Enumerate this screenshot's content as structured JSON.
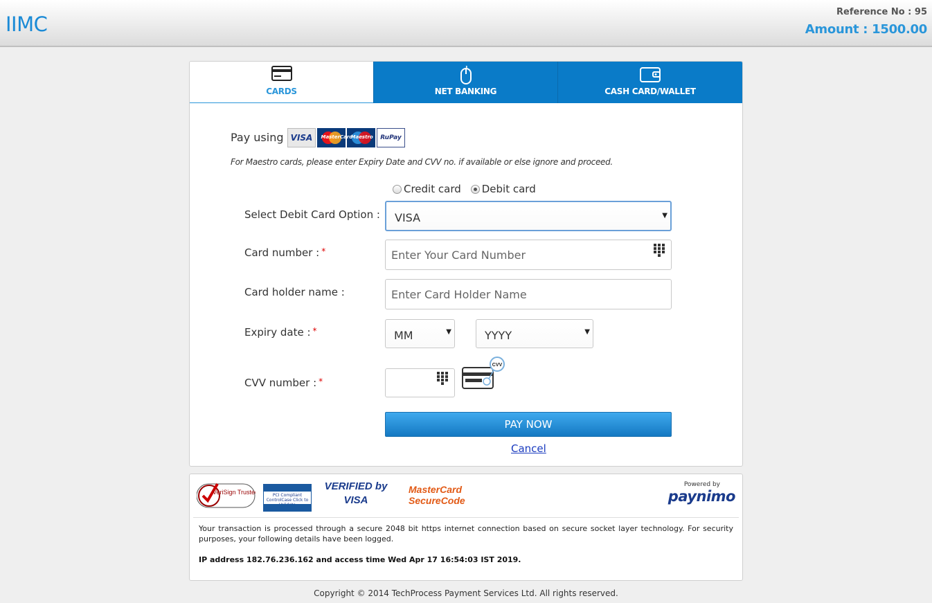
{
  "header": {
    "logo": "IIMC",
    "reference": "Reference No : 95",
    "amount": "Amount : 1500.00"
  },
  "tabs": [
    {
      "label": "CARDS",
      "icon": "credit-card-icon",
      "active": true
    },
    {
      "label": "NET BANKING",
      "icon": "mouse-icon",
      "active": false
    },
    {
      "label": "CASH CARD/WALLET",
      "icon": "wallet-icon",
      "active": false
    }
  ],
  "pay_using": {
    "label": "Pay using",
    "logos": [
      "VISA",
      "MasterCard",
      "Maestro",
      "RuPay"
    ]
  },
  "maestro_note": "For Maestro cards, please enter Expiry Date and CVV no. if available or else ignore and proceed.",
  "card_type": {
    "options": [
      "Credit card",
      "Debit card"
    ],
    "selected": "Debit card"
  },
  "form": {
    "debit_option_label": "Select Debit Card Option :",
    "debit_option_value": "VISA",
    "card_number_label": "Card number :",
    "card_number_placeholder": "Enter Your Card Number",
    "holder_label": "Card holder name :",
    "holder_placeholder": "Enter Card Holder Name",
    "expiry_label": "Expiry date :",
    "expiry_month": "MM",
    "expiry_year": "YYYY",
    "cvv_label": "CVV number :",
    "required_mark": "*",
    "cvv_badge": "CVV"
  },
  "actions": {
    "pay_now": "PAY NOW",
    "cancel": "Cancel"
  },
  "security": {
    "badges": [
      "VeriSign Trusted",
      "PCI Compliant ControlCase Click to Validate",
      "VERIFIED by VISA",
      "MasterCard SecureCode"
    ],
    "powered_by": "Powered by",
    "provider": "paynimo",
    "text": "Your transaction is processed through a secure 2048 bit https internet connection based on secure socket layer technology. For security purposes, your following details have been logged.",
    "ip_line": "IP address 182.76.236.162 and access time Wed Apr 17 16:54:03 IST 2019."
  },
  "footer": {
    "copyright": "Copyright © 2014 TechProcess Payment Services Ltd. All rights reserved."
  },
  "colors": {
    "accent": "#2a96da",
    "tab_blue": "#0a7bc8",
    "button_blue": "#1479c2"
  }
}
